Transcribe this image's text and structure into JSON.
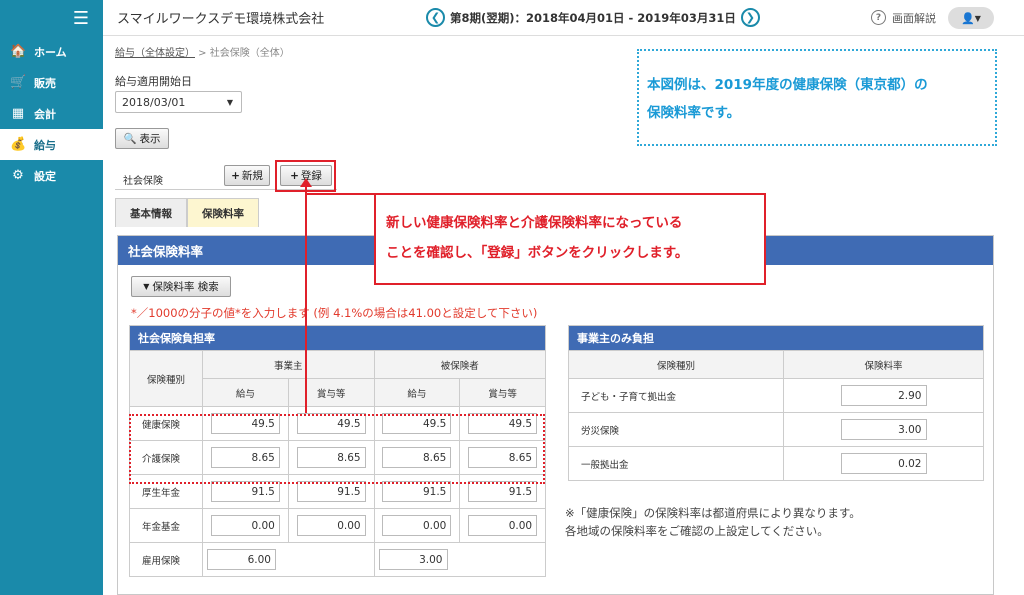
{
  "sidebar": {
    "items": [
      {
        "label": "ホーム",
        "icon": "home-icon",
        "glyph": "🏠"
      },
      {
        "label": "販売",
        "icon": "cart-icon",
        "glyph": "🛒"
      },
      {
        "label": "会計",
        "icon": "calculator-icon",
        "glyph": "▦"
      },
      {
        "label": "給与",
        "icon": "money-bag-icon",
        "glyph": "💰"
      },
      {
        "label": "設定",
        "icon": "gear-icon",
        "glyph": "⚙"
      }
    ]
  },
  "header": {
    "company": "スマイルワークスデモ環境株式会社",
    "period": "第8期(翌期)：2018年04月01日 - 2019年03月31日",
    "help": "画面解説"
  },
  "breadcrumb": {
    "link": "給与（全体設定）",
    "sep": " > ",
    "current": "社会保険（全体）"
  },
  "form": {
    "date_label": "給与適用開始日",
    "date_value": "2018/03/01",
    "view_button": "表示",
    "section_label": "社会保険",
    "new_button": "新規",
    "register_button": "登録"
  },
  "tabs": [
    "基本情報",
    "保険料率"
  ],
  "panel": {
    "title": "社会保険料率",
    "search_button": "保険料率 検索",
    "note": "*／1000の分子の値*を入力します (例 4.1%の場合は41.00と設定して下さい)"
  },
  "burden_table": {
    "title": "社会保険負担率",
    "col_type": "保険種別",
    "col_employer": "事業主",
    "col_insured": "被保険者",
    "sub_salary": "給与",
    "sub_bonus": "賞与等",
    "rows": [
      {
        "label": "健康保険",
        "values": [
          "49.5",
          "49.5",
          "49.5",
          "49.5"
        ]
      },
      {
        "label": "介護保険",
        "values": [
          "8.65",
          "8.65",
          "8.65",
          "8.65"
        ]
      },
      {
        "label": "厚生年金",
        "values": [
          "91.5",
          "91.5",
          "91.5",
          "91.5"
        ]
      },
      {
        "label": "年金基金",
        "values": [
          "0.00",
          "0.00",
          "0.00",
          "0.00"
        ]
      },
      {
        "label": "雇用保険",
        "values": [
          "6.00",
          "",
          "3.00",
          ""
        ]
      }
    ]
  },
  "employer_table": {
    "title": "事業主のみ負担",
    "col_type": "保険種別",
    "col_rate": "保険料率",
    "rows": [
      {
        "label": "子ども・子育て拠出金",
        "value": "2.90"
      },
      {
        "label": "労災保険",
        "value": "3.00"
      },
      {
        "label": "一般拠出金",
        "value": "0.02"
      }
    ]
  },
  "remark": [
    "※「健康保険」の保険料率は都道府県により異なります。",
    "各地域の保険料率をご確認の上設定してください。"
  ],
  "callout_info": [
    "本図例は、2019年度の健康保険（東京都）の",
    "保険料率です。"
  ],
  "callout_instruction": [
    "新しい健康保険料率と介護保険料率になっている",
    "ことを確認し、「登録」ボタンをクリックします。"
  ]
}
